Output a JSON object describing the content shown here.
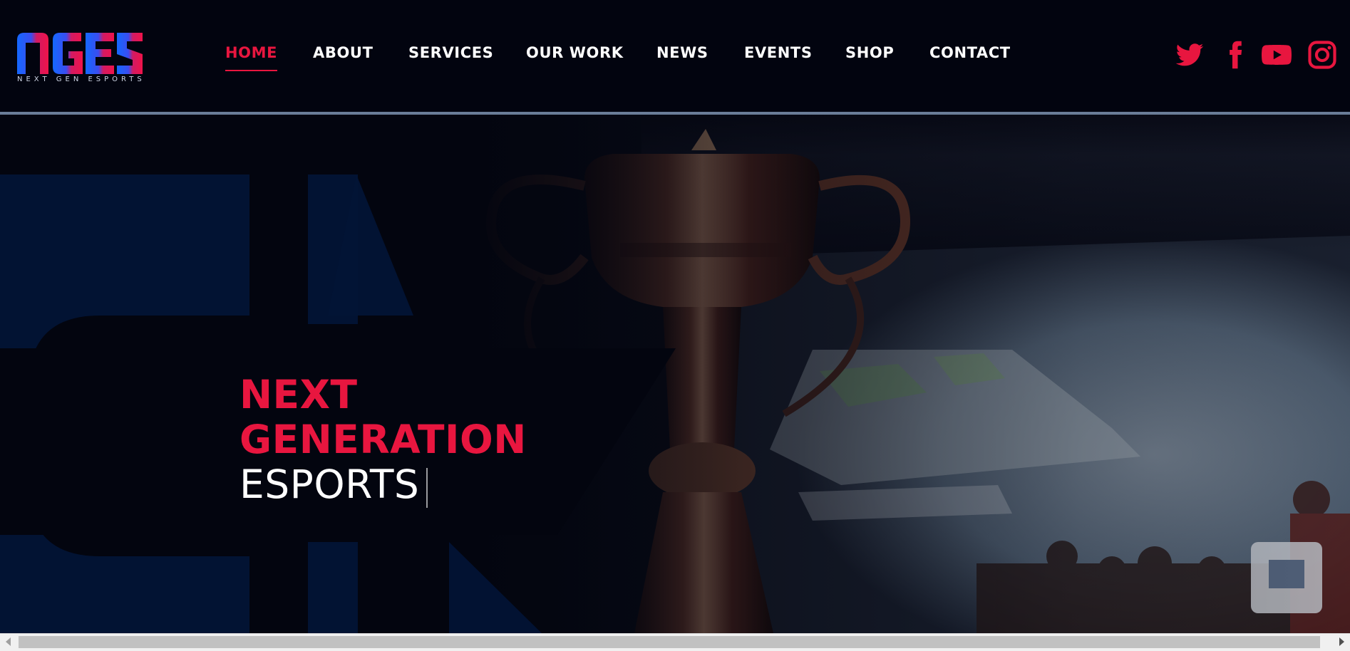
{
  "brand": {
    "logo_letters": "NGES",
    "tagline": "NEXT GEN ESPORTS"
  },
  "nav": {
    "items": [
      {
        "label": "HOME",
        "active": true
      },
      {
        "label": "ABOUT"
      },
      {
        "label": "SERVICES"
      },
      {
        "label": "OUR WORK"
      },
      {
        "label": "NEWS"
      },
      {
        "label": "EVENTS"
      },
      {
        "label": "SHOP"
      },
      {
        "label": "CONTACT"
      }
    ]
  },
  "social": [
    "twitter-icon",
    "facebook-icon",
    "youtube-icon",
    "instagram-icon"
  ],
  "hero": {
    "line1": "NEXT",
    "line2": "GENERATION",
    "line3": "ESPORTS"
  },
  "colors": {
    "accent": "#e8163f",
    "background": "#02040f",
    "nav_text": "#ffffff",
    "logo_blue": "#1c5cf5"
  }
}
